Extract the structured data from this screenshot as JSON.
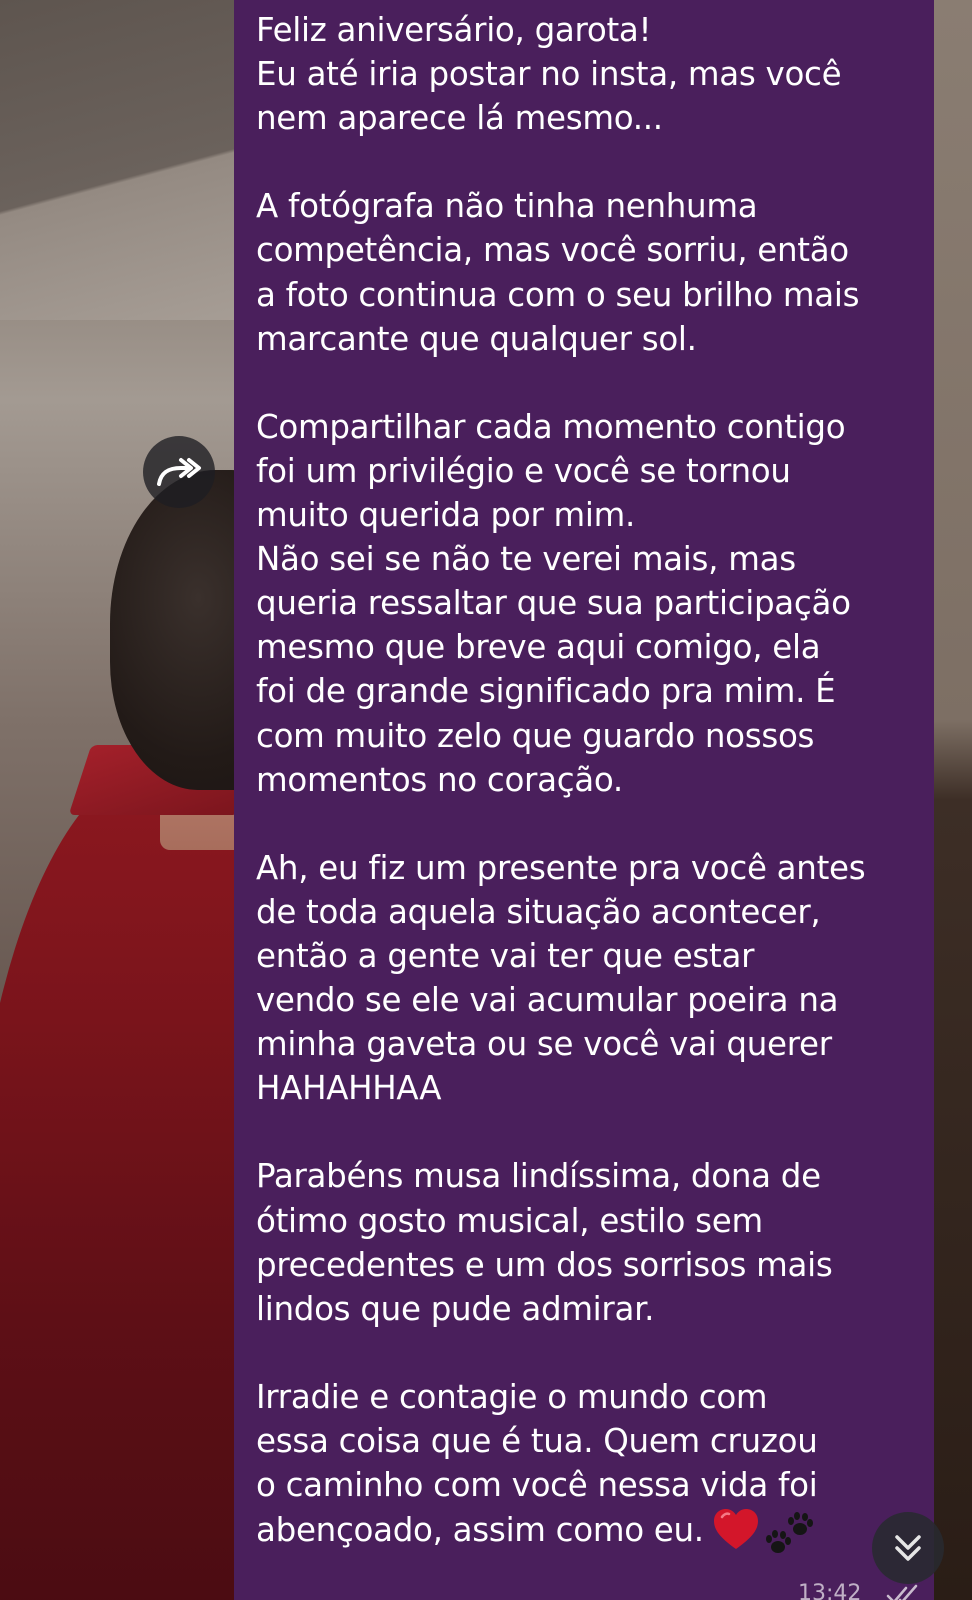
{
  "message": {
    "text": "Feliz aniversário, garota!\nEu até iria postar no insta, mas você\nnem aparece lá mesmo...\n\nA fotógrafa não tinha nenhuma\ncompetência, mas você sorriu, então\na foto continua com o seu brilho mais\nmarcante que qualquer sol.\n\nCompartilhar cada momento contigo\nfoi um privilégio e você se tornou\nmuito querida por mim.\nNão sei se não te verei mais, mas\nqueria ressaltar que sua participação\nmesmo que breve aqui comigo, ela\nfoi de grande significado pra mim. É\ncom muito zelo que guardo nossos\nmomentos no coração.\n\nAh, eu fiz um presente pra você antes\nde toda aquela situação acontecer,\nentão a gente vai ter que estar\nvendo se ele vai acumular poeira na\nminha gaveta ou se você vai querer\nHAHAHHAA\n\nParabéns musa lindíssima, dona de\nótimo gosto musical, estilo sem\nprecedentes e um dos sorrisos mais\nlindos que pude admirar.\n\nIrradie e contagie o mundo com\nessa coisa que é tua. Quem cruzou\no caminho com você nessa vida foi\n",
    "last_line": "abençoado, assim como eu.",
    "emojis": [
      "heart-icon",
      "paw-prints-icon"
    ],
    "timestamp": "13:42",
    "status": "read"
  },
  "colors": {
    "bubble": "#4a1f5c",
    "text": "#ffffff",
    "heart": "#d3162a"
  },
  "icons": {
    "forward": "forward-arrow-icon",
    "scroll_down": "double-chevron-down-icon"
  }
}
